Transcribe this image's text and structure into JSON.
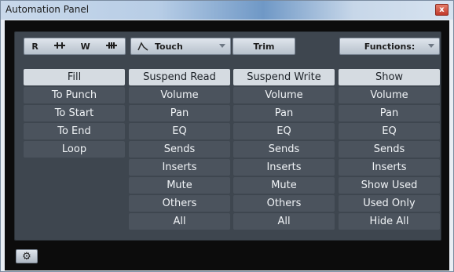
{
  "window": {
    "title": "Automation Panel",
    "close_label": "x"
  },
  "toolbar": {
    "mode_icons": [
      "R",
      "⽾",
      "W",
      "⽾"
    ],
    "mode_value": "Touch",
    "trim_label": "Trim",
    "functions_label": "Functions:"
  },
  "columns": [
    {
      "header": "Fill",
      "items": [
        "To Punch",
        "To Start",
        "To End",
        "Loop"
      ]
    },
    {
      "header": "Suspend Read",
      "items": [
        "Volume",
        "Pan",
        "EQ",
        "Sends",
        "Inserts",
        "Mute",
        "Others",
        "All"
      ]
    },
    {
      "header": "Suspend Write",
      "items": [
        "Volume",
        "Pan",
        "EQ",
        "Sends",
        "Inserts",
        "Mute",
        "Others",
        "All"
      ]
    },
    {
      "header": "Show",
      "items": [
        "Volume",
        "Pan",
        "EQ",
        "Sends",
        "Inserts",
        "Show Used",
        "Used Only",
        "Hide All"
      ]
    }
  ]
}
